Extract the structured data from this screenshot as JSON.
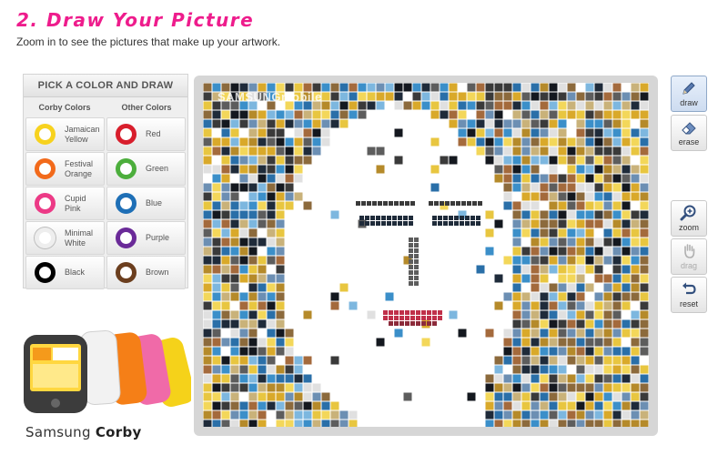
{
  "header": {
    "title": "2. Draw Your Picture",
    "subtitle": "Zoom in to see the pictures that make up your artwork."
  },
  "picker": {
    "heading": "PICK A COLOR AND DRAW",
    "col1_heading": "Corby Colors",
    "col2_heading": "Other Colors",
    "swatches": [
      {
        "label": "Jamaican\nYellow",
        "color": "#f7d21e"
      },
      {
        "label": "Red",
        "color": "#d81e2c"
      },
      {
        "label": "Festival\nOrange",
        "color": "#f26a1b"
      },
      {
        "label": "Green",
        "color": "#4cae3c"
      },
      {
        "label": "Cupid\nPink",
        "color": "#ec3a86"
      },
      {
        "label": "Blue",
        "color": "#1e6fb6"
      },
      {
        "label": "Minimal\nWhite",
        "color": "#eeeeee"
      },
      {
        "label": "Purple",
        "color": "#6a2a98"
      },
      {
        "label": "Black",
        "color": "#000000"
      },
      {
        "label": "Brown",
        "color": "#6b3e1e"
      }
    ]
  },
  "canvas": {
    "watermark": "SAMSUNGmobile"
  },
  "tools": {
    "draw": {
      "label": "draw",
      "icon": "pencil-icon"
    },
    "erase": {
      "label": "erase",
      "icon": "eraser-icon"
    },
    "zoom": {
      "label": "zoom",
      "icon": "magnifier-plus-icon"
    },
    "drag": {
      "label": "drag",
      "icon": "hand-icon"
    },
    "reset": {
      "label": "reset",
      "icon": "undo-arrow-icon"
    }
  },
  "brand": {
    "name1": "Samsung",
    "name2": "Corby"
  },
  "colors": {
    "accent": "#ee1c8c"
  }
}
